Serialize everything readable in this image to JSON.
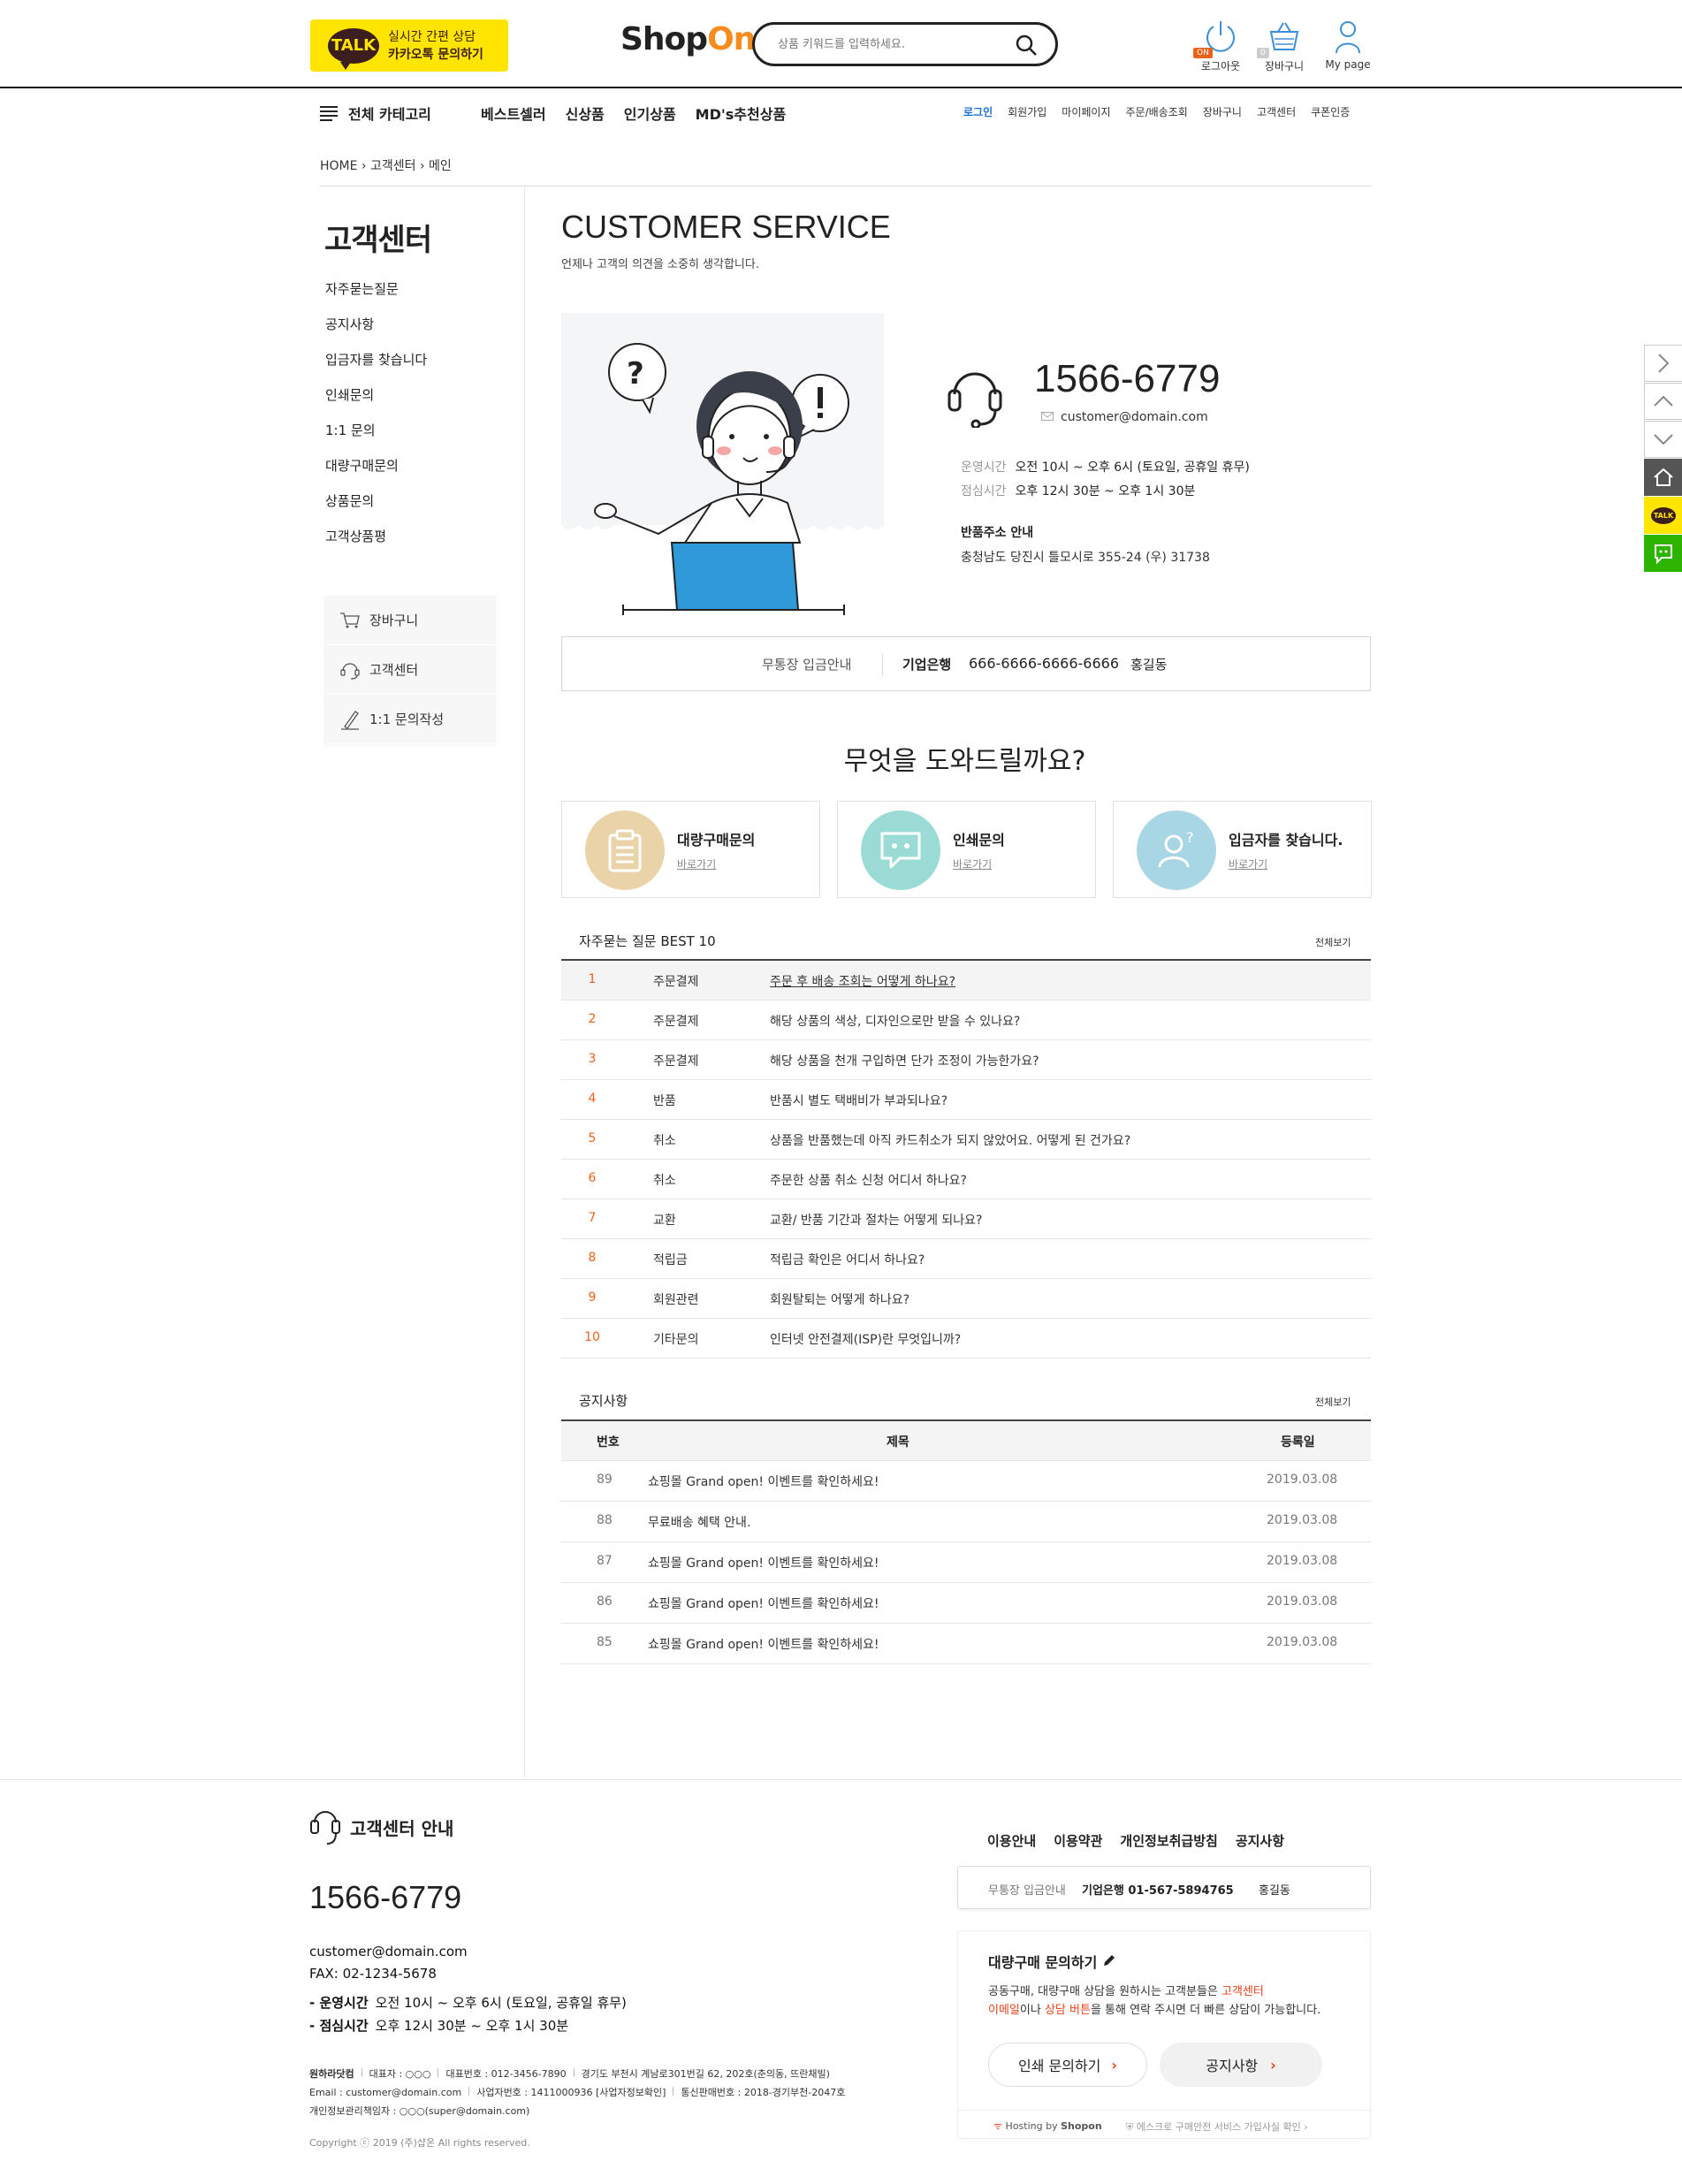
{
  "header": {
    "kakao": {
      "talk": "TALK",
      "line1": "실시간 간편 상담",
      "line2": "카카오톡 문의하기"
    },
    "logo": {
      "shop": "Shop",
      "on": "On"
    },
    "search": {
      "placeholder": "상품 키워드를 입력하세요."
    },
    "icons": [
      {
        "label": "로그아웃",
        "badge": "ON"
      },
      {
        "label": "장바구니",
        "badge": "0"
      },
      {
        "label": "My page"
      }
    ]
  },
  "nav": {
    "category": "전체 카테고리",
    "main": [
      "베스트셀러",
      "신상품",
      "인기상품",
      "MD's추천상품"
    ],
    "util": [
      "로그인",
      "회원가입",
      "마이페이지",
      "주문/배송조회",
      "장바구니",
      "고객센터",
      "쿠폰인증"
    ]
  },
  "breadcrumb": {
    "home": "HOME",
    "cs": "고객센터",
    "current": "메인"
  },
  "sidebar": {
    "title": "고객센터",
    "menu": [
      "자주묻는질문",
      "공지사항",
      "입금자를 찾습니다",
      "인쇄문의",
      "1:1 문의",
      "대량구매문의",
      "상품문의",
      "고객상품평"
    ],
    "box": [
      "장바구니",
      "고객센터",
      "1:1 문의작성"
    ]
  },
  "main": {
    "title": "CUSTOMER SERVICE",
    "subtitle": "언제나 고객의 의견을 소중히 생각합니다.",
    "tel": "1566-6779",
    "email": "customer@domain.com",
    "hours_label": "운영시간",
    "hours": "오전 10시 ~ 오후 6시 (토요일, 공휴일 휴무)",
    "lunch_label": "점심시간",
    "lunch": "오후 12시 30분 ~ 오후 1시 30분",
    "return_title": "반품주소 안내",
    "return_addr": "충청남도 당진시 틀모시로 355-24 (우) 31738",
    "bank": {
      "label": "무통장 입금안내",
      "bank": "기업은행",
      "account": "666-6666-6666-6666",
      "holder": "홍길동"
    },
    "help_title": "무엇을 도와드릴까요?",
    "help_cards": [
      {
        "title": "대량구매문의",
        "link": "바로가기",
        "color": "#ead3a8"
      },
      {
        "title": "인쇄문의",
        "link": "바로가기",
        "color": "#9bdbd6"
      },
      {
        "title": "입금자를 찾습니다.",
        "link": "바로가기",
        "color": "#a9d6e5"
      }
    ],
    "faq_title": "자주묻는 질문 BEST 10",
    "faq_more": "전체보기",
    "faq": [
      {
        "no": "1",
        "cat": "주문결제",
        "q": "주문 후 배송 조회는 어떻게 하나요?"
      },
      {
        "no": "2",
        "cat": "주문결제",
        "q": "해당 상품의 색상, 디자인으로만 받을 수 있나요?"
      },
      {
        "no": "3",
        "cat": "주문결제",
        "q": "해당 상품을 천개 구입하면 단가 조정이 가능한가요?"
      },
      {
        "no": "4",
        "cat": "반품",
        "q": "반품시 별도 택배비가 부과되나요?"
      },
      {
        "no": "5",
        "cat": "취소",
        "q": "상품을 반품했는데 아직 카드취소가 되지 않았어요. 어떻게 된 건가요?"
      },
      {
        "no": "6",
        "cat": "취소",
        "q": "주문한 상품 취소 신청 어디서 하나요?"
      },
      {
        "no": "7",
        "cat": "교환",
        "q": "교환/ 반품 기간과 절차는 어떻게 되나요?"
      },
      {
        "no": "8",
        "cat": "적립금",
        "q": "적립금 확인은 어디서 하나요?"
      },
      {
        "no": "9",
        "cat": "회원관련",
        "q": "회원탈퇴는 어떻게 하나요?"
      },
      {
        "no": "10",
        "cat": "기타문의",
        "q": "인터넷 안전결제(ISP)란 무엇입니까?"
      }
    ],
    "notice_title": "공지사항",
    "notice_more": "전체보기",
    "notice_head": {
      "no": "번호",
      "title": "제목",
      "date": "등록일"
    },
    "notices": [
      {
        "no": "89",
        "title": "쇼핑몰 Grand open! 이벤트를 확인하세요!",
        "date": "2019.03.08"
      },
      {
        "no": "88",
        "title": "무료배송 혜택 안내.",
        "date": "2019.03.08"
      },
      {
        "no": "87",
        "title": "쇼핑몰 Grand open! 이벤트를 확인하세요!",
        "date": "2019.03.08"
      },
      {
        "no": "86",
        "title": "쇼핑몰 Grand open! 이벤트를 확인하세요!",
        "date": "2019.03.08"
      },
      {
        "no": "85",
        "title": "쇼핑몰 Grand open! 이벤트를 확인하세요!",
        "date": "2019.03.08"
      }
    ]
  },
  "quickbar": {
    "talk": "TALK"
  },
  "footer": {
    "cs_title": "고객센터 안내",
    "tel": "1566-6779",
    "email": "customer@domain.com",
    "fax": "FAX: 02-1234-5678",
    "hours": "- 운영시간",
    "hours_val": "오전 10시 ~ 오후 6시 (토요일, 공휴일 휴무)",
    "lunch": "- 점심시간",
    "lunch_val": "오후 12시 30분 ~ 오후 1시 30분",
    "legal1": [
      "원하라닷컴",
      "대표자 : ○○○",
      "대표번호 : 012-3456-7890",
      "경기도 부천시 계남로301번길 62, 202호(춘의동, 뜨란채빌)"
    ],
    "legal2": [
      "Email : customer@domain.com",
      "사업자번호 : 1411000936 [사업자정보확인]",
      "통신판매번호 : 2018-경기부천-2047호"
    ],
    "legal3": "개인정보관리책임자 : ○○○(super@domain.com)",
    "copyright": "Copyright ⓒ 2019 (주)샵온 All rights reserved.",
    "links": [
      "이용안내",
      "이용약관",
      "개인정보취급방침",
      "공지사항"
    ],
    "bank": {
      "label": "무통장 입금안내",
      "bank": "기업은행 01-567-5894765",
      "holder": "홍길동"
    },
    "bulk": {
      "title": "대량구매 문의하기",
      "desc1a": "공동구매, 대량구매 상담을 원하시는 고객분들은 ",
      "desc1b": "고객센터",
      "desc2a": "이메일",
      "desc2b": "이나 ",
      "desc2c": "상담 버튼",
      "desc2d": "을 통해 연락 주시면 더 빠른 상담이 가능합니다.",
      "btn1": "인쇄 문의하기",
      "btn2": "공지사항",
      "hosting": "Hosting by",
      "hosting_brand": "Shopon",
      "escrow": "에스크로 구매안전 서비스 가입사실 확인"
    }
  }
}
